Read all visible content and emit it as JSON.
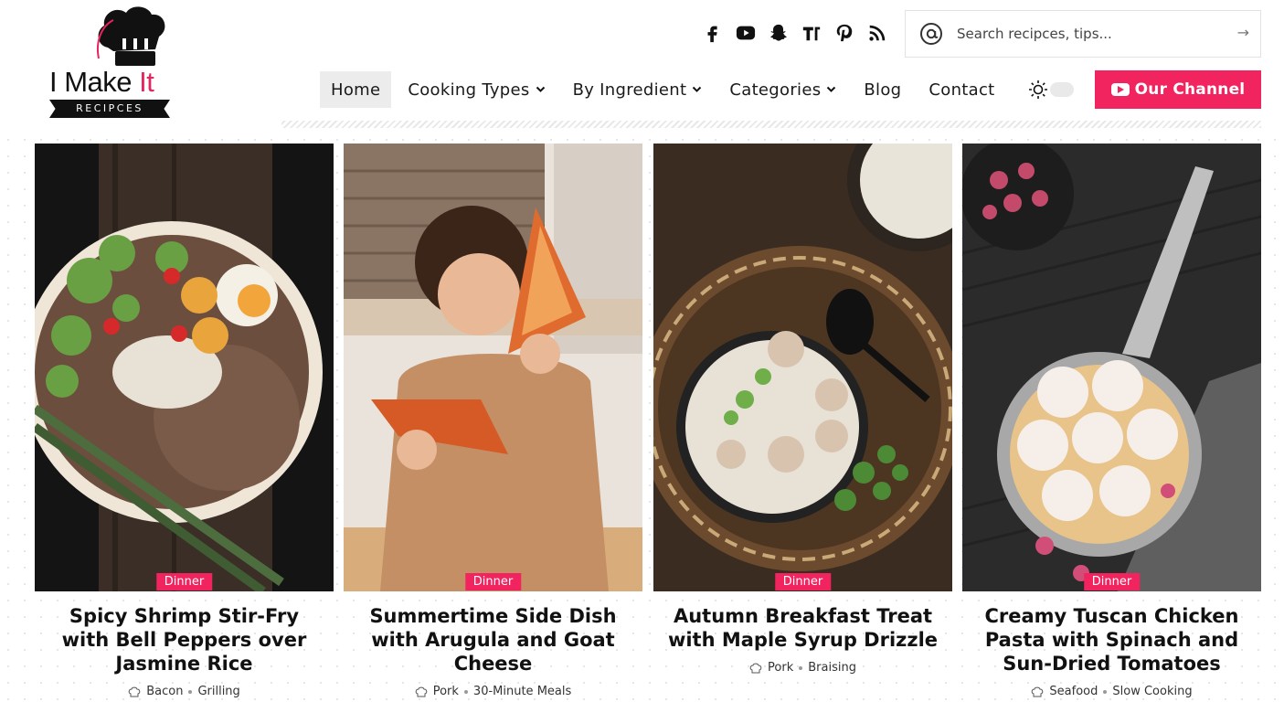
{
  "brand": {
    "title_main": "I Make ",
    "title_accent": "It",
    "subtitle": "RECIPCES"
  },
  "socials": [
    {
      "name": "facebook-icon"
    },
    {
      "name": "youtube-icon"
    },
    {
      "name": "snapchat-icon"
    },
    {
      "name": "tiktok-icon"
    },
    {
      "name": "pinterest-icon"
    },
    {
      "name": "rss-icon"
    }
  ],
  "search": {
    "placeholder": "Search recipces, tips...",
    "submit_icon": "arrow-right-icon"
  },
  "nav": {
    "items": [
      {
        "label": "Home",
        "active": true
      },
      {
        "label": "Cooking Types",
        "dropdown": true
      },
      {
        "label": "By Ingredient",
        "dropdown": true
      },
      {
        "label": "Categories",
        "dropdown": true
      },
      {
        "label": "Blog"
      },
      {
        "label": "Contact"
      }
    ],
    "theme_toggle_icon": "sun-icon"
  },
  "channel_button": {
    "label": "Our Channel"
  },
  "cards": [
    {
      "category": "Dinner",
      "title": "Spicy Shrimp Stir-Fry with Bell Peppers over Jasmine Rice",
      "tags": [
        "Bacon",
        "Grilling"
      ]
    },
    {
      "category": "Dinner",
      "title": "Summertime Side Dish with Arugula and Goat Cheese",
      "tags": [
        "Pork",
        "30-Minute Meals"
      ]
    },
    {
      "category": "Dinner",
      "title": "Autumn Breakfast Treat with Maple Syrup Drizzle",
      "tags": [
        "Pork",
        "Braising"
      ]
    },
    {
      "category": "Dinner",
      "title": "Creamy Tuscan Chicken Pasta with Spinach and Sun-Dried Tomatoes",
      "tags": [
        "Seafood",
        "Slow Cooking"
      ]
    }
  ],
  "colors": {
    "accent": "#f2245f",
    "text": "#111111"
  }
}
